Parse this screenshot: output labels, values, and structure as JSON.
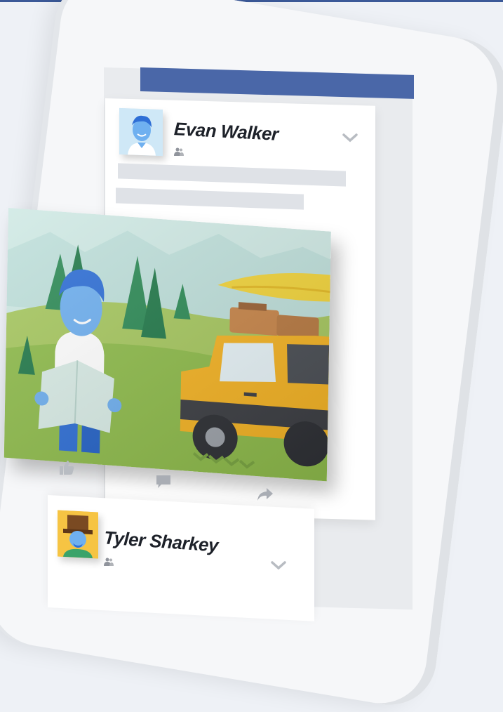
{
  "posts": [
    {
      "author": "Evan Walker",
      "audience_icon": "friends-icon",
      "menu_icon": "chevron-down-icon"
    },
    {
      "author": "Tyler Sharkey",
      "audience_icon": "friends-icon",
      "menu_icon": "chevron-down-icon"
    }
  ],
  "actions": [
    {
      "icon": "like-icon"
    },
    {
      "icon": "comment-icon"
    },
    {
      "icon": "share-icon"
    }
  ],
  "colors": {
    "brand": "#3b5998",
    "header_bar": "#4a67a8",
    "background": "#eef1f6",
    "card": "#ffffff",
    "placeholder_line": "#dfe2e7"
  }
}
